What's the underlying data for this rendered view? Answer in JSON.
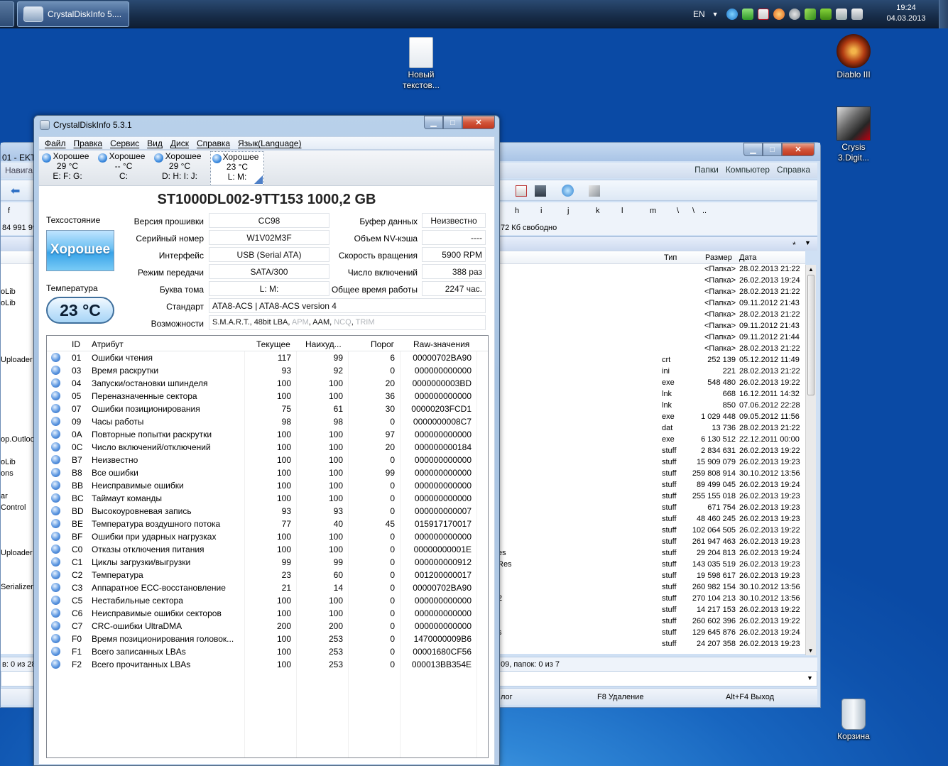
{
  "taskbar": {
    "task_button_label": "CrystalDiskInfo 5....",
    "lang": "EN",
    "time": "19:24",
    "date": "04.03.2013"
  },
  "desktop_icons": {
    "new_text": "Новый текстов...",
    "diablo": "Diablo III",
    "crysis": "Crysis 3.Digit...",
    "recycle": "Корзина"
  },
  "file_manager": {
    "title_fragment": "01 - EKT",
    "nav_fragment": "Навига",
    "menu": [
      "Папки",
      "Компьютер",
      "Справка"
    ],
    "drive_letters": [
      "h",
      "i",
      "j",
      "k",
      "l",
      "m",
      "\\",
      ".."
    ],
    "left_drive_fragment": "f",
    "left_free_fragment": "84 991 99",
    "free_text": "72 Кб свободно",
    "col_type": "Тип",
    "col_size": "Размер",
    "col_date": "Дата",
    "filter_star": "*",
    "left_names": [
      "",
      "",
      "oLib",
      "oLib",
      "",
      "",
      "",
      "",
      "Uploader",
      "",
      "",
      "",
      "",
      "",
      "",
      "op.Outlook",
      "",
      "oLib",
      "ons",
      "",
      "ar",
      "Control",
      "",
      "",
      "",
      "Uploader",
      "",
      "",
      "Serializers",
      "",
      "",
      "",
      "",
      "",
      "",
      ""
    ],
    "mid_names": [
      "",
      "",
      "",
      "",
      "",
      "",
      "",
      "",
      "",
      "",
      "",
      "",
      "",
      "",
      "",
      "",
      "",
      "",
      "",
      "",
      "",
      "",
      "",
      "",
      "",
      "es",
      "Res",
      "",
      "",
      "2",
      "",
      "",
      "s",
      "",
      "",
      ""
    ],
    "rows": [
      {
        "type": "",
        "size": "<Папка>",
        "date": "28.02.2013 21:22"
      },
      {
        "type": "",
        "size": "<Папка>",
        "date": "26.02.2013 19:24"
      },
      {
        "type": "",
        "size": "<Папка>",
        "date": "28.02.2013 21:22"
      },
      {
        "type": "",
        "size": "<Папка>",
        "date": "09.11.2012 21:43"
      },
      {
        "type": "",
        "size": "<Папка>",
        "date": "28.02.2013 21:22"
      },
      {
        "type": "",
        "size": "<Папка>",
        "date": "09.11.2012 21:43"
      },
      {
        "type": "",
        "size": "<Папка>",
        "date": "09.11.2012 21:44"
      },
      {
        "type": "",
        "size": "<Папка>",
        "date": "28.02.2013 21:22"
      },
      {
        "type": "crt",
        "size": "252 139",
        "date": "05.12.2012 11:49"
      },
      {
        "type": "ini",
        "size": "221",
        "date": "28.02.2013 21:22"
      },
      {
        "type": "exe",
        "size": "548 480",
        "date": "26.02.2013 19:22"
      },
      {
        "type": "lnk",
        "size": "668",
        "date": "16.12.2011 14:32"
      },
      {
        "type": "lnk",
        "size": "850",
        "date": "07.06.2012 22:28"
      },
      {
        "type": "exe",
        "size": "1 029 448",
        "date": "09.05.2012 11:56"
      },
      {
        "type": "dat",
        "size": "13 736",
        "date": "28.02.2013 21:22"
      },
      {
        "type": "exe",
        "size": "6 130 512",
        "date": "22.12.2011 00:00"
      },
      {
        "type": "stuff",
        "size": "2 834 631",
        "date": "26.02.2013 19:22"
      },
      {
        "type": "stuff",
        "size": "15 909 079",
        "date": "26.02.2013 19:23"
      },
      {
        "type": "stuff",
        "size": "259 808 914",
        "date": "30.10.2012 13:56"
      },
      {
        "type": "stuff",
        "size": "89 499 045",
        "date": "26.02.2013 19:24"
      },
      {
        "type": "stuff",
        "size": "255 155 018",
        "date": "26.02.2013 19:23"
      },
      {
        "type": "stuff",
        "size": "671 754",
        "date": "26.02.2013 19:23"
      },
      {
        "type": "stuff",
        "size": "48 460 245",
        "date": "26.02.2013 19:23"
      },
      {
        "type": "stuff",
        "size": "102 064 505",
        "date": "26.02.2013 19:22"
      },
      {
        "type": "stuff",
        "size": "261 947 463",
        "date": "26.02.2013 19:23"
      },
      {
        "type": "stuff",
        "size": "29 204 813",
        "date": "26.02.2013 19:24"
      },
      {
        "type": "stuff",
        "size": "143 035 519",
        "date": "26.02.2013 19:23"
      },
      {
        "type": "stuff",
        "size": "19 598 617",
        "date": "26.02.2013 19:23"
      },
      {
        "type": "stuff",
        "size": "260 982 154",
        "date": "30.10.2012 13:56"
      },
      {
        "type": "stuff",
        "size": "270 104 213",
        "date": "30.10.2012 13:56"
      },
      {
        "type": "stuff",
        "size": "14 217 153",
        "date": "26.02.2013 19:22"
      },
      {
        "type": "stuff",
        "size": "260 602 396",
        "date": "26.02.2013 19:22"
      },
      {
        "type": "stuff",
        "size": "129 645 876",
        "date": "26.02.2013 19:24"
      },
      {
        "type": "stuff",
        "size": "24 207 358",
        "date": "26.02.2013 19:23"
      }
    ],
    "status_left": "в: 0 из 28",
    "status_right": "09, папок: 0 из 7",
    "fkey_left": "лог",
    "fkey_f8": "F8 Удаление",
    "fkey_exit": "Alt+F4 Выход"
  },
  "cdi": {
    "title": "CrystalDiskInfo 5.3.1",
    "menu": [
      "Файл",
      "Правка",
      "Сервис",
      "Вид",
      "Диск",
      "Справка",
      "Язык(Language)"
    ],
    "disk_tabs": [
      {
        "status": "Хорошее",
        "temp": "29 °C",
        "letters": "E: F: G:"
      },
      {
        "status": "Хорошее",
        "temp": "-- °C",
        "letters": "C:"
      },
      {
        "status": "Хорошее",
        "temp": "29 °C",
        "letters": "D: H: I: J:"
      },
      {
        "status": "Хорошее",
        "temp": "23 °C",
        "letters": "L: M:"
      }
    ],
    "model": "ST1000DL002-9TT153  1000,2 GB",
    "health_label": "Техсостояние",
    "health_value": "Хорошее",
    "temp_label": "Температура",
    "temp_value": "23 °C",
    "fields_left": [
      {
        "label": "Версия прошивки",
        "value": "CC98"
      },
      {
        "label": "Серийный номер",
        "value": "W1V02M3F"
      },
      {
        "label": "Интерфейс",
        "value": "USB (Serial ATA)"
      },
      {
        "label": "Режим передачи",
        "value": "SATA/300"
      },
      {
        "label": "Буква тома",
        "value": "L: M:"
      }
    ],
    "fields_right": [
      {
        "label": "Буфер данных",
        "value": "Неизвестно"
      },
      {
        "label": "Объем NV-кэша",
        "value": "----"
      },
      {
        "label": "Скорость вращения",
        "value": "5900 RPM"
      },
      {
        "label": "Число включений",
        "value": "388 раз"
      },
      {
        "label": "Общее время работы",
        "value": "2247 час."
      }
    ],
    "standard_label": "Стандарт",
    "standard_value": "ATA8-ACS | ATA8-ACS version 4",
    "features_label": "Возможности",
    "features": [
      "S.M.A.R.T.",
      "48bit LBA",
      "APM",
      "AAM",
      "NCQ",
      "TRIM"
    ],
    "features_dim": [
      false,
      false,
      true,
      false,
      true,
      true
    ],
    "table_headers": [
      "ID",
      "Атрибут",
      "Текущее",
      "Наихуд...",
      "Порог",
      "Raw-значения"
    ],
    "attributes": [
      {
        "id": "01",
        "name": "Ошибки чтения",
        "cur": "117",
        "worst": "99",
        "thr": "6",
        "raw": "00000702BA90"
      },
      {
        "id": "03",
        "name": "Время раскрутки",
        "cur": "93",
        "worst": "92",
        "thr": "0",
        "raw": "000000000000"
      },
      {
        "id": "04",
        "name": "Запуски/остановки шпинделя",
        "cur": "100",
        "worst": "100",
        "thr": "20",
        "raw": "0000000003BD"
      },
      {
        "id": "05",
        "name": "Переназначенные сектора",
        "cur": "100",
        "worst": "100",
        "thr": "36",
        "raw": "000000000000"
      },
      {
        "id": "07",
        "name": "Ошибки позиционирования",
        "cur": "75",
        "worst": "61",
        "thr": "30",
        "raw": "00000203FCD1"
      },
      {
        "id": "09",
        "name": "Часы работы",
        "cur": "98",
        "worst": "98",
        "thr": "0",
        "raw": "0000000008C7"
      },
      {
        "id": "0A",
        "name": "Повторные попытки раскрутки",
        "cur": "100",
        "worst": "100",
        "thr": "97",
        "raw": "000000000000"
      },
      {
        "id": "0C",
        "name": "Число включений/отключений",
        "cur": "100",
        "worst": "100",
        "thr": "20",
        "raw": "000000000184"
      },
      {
        "id": "B7",
        "name": "Неизвестно",
        "cur": "100",
        "worst": "100",
        "thr": "0",
        "raw": "000000000000"
      },
      {
        "id": "B8",
        "name": "Все ошибки",
        "cur": "100",
        "worst": "100",
        "thr": "99",
        "raw": "000000000000"
      },
      {
        "id": "BB",
        "name": "Неисправимые ошибки",
        "cur": "100",
        "worst": "100",
        "thr": "0",
        "raw": "000000000000"
      },
      {
        "id": "BC",
        "name": "Таймаут команды",
        "cur": "100",
        "worst": "100",
        "thr": "0",
        "raw": "000000000000"
      },
      {
        "id": "BD",
        "name": "Высокоуровневая запись",
        "cur": "93",
        "worst": "93",
        "thr": "0",
        "raw": "000000000007"
      },
      {
        "id": "BE",
        "name": "Температура воздушного потока",
        "cur": "77",
        "worst": "40",
        "thr": "45",
        "raw": "015917170017"
      },
      {
        "id": "BF",
        "name": "Ошибки при ударных нагрузках",
        "cur": "100",
        "worst": "100",
        "thr": "0",
        "raw": "000000000000"
      },
      {
        "id": "C0",
        "name": "Отказы отключения питания",
        "cur": "100",
        "worst": "100",
        "thr": "0",
        "raw": "00000000001E"
      },
      {
        "id": "C1",
        "name": "Циклы загрузки/выгрузки",
        "cur": "99",
        "worst": "99",
        "thr": "0",
        "raw": "000000000912"
      },
      {
        "id": "C2",
        "name": "Температура",
        "cur": "23",
        "worst": "60",
        "thr": "0",
        "raw": "001200000017"
      },
      {
        "id": "C3",
        "name": "Аппаратное ECC-восстановление",
        "cur": "21",
        "worst": "14",
        "thr": "0",
        "raw": "00000702BA90"
      },
      {
        "id": "C5",
        "name": "Нестабильные сектора",
        "cur": "100",
        "worst": "100",
        "thr": "0",
        "raw": "000000000000"
      },
      {
        "id": "C6",
        "name": "Неисправимые ошибки секторов",
        "cur": "100",
        "worst": "100",
        "thr": "0",
        "raw": "000000000000"
      },
      {
        "id": "C7",
        "name": "CRC-ошибки UltraDMA",
        "cur": "200",
        "worst": "200",
        "thr": "0",
        "raw": "000000000000"
      },
      {
        "id": "F0",
        "name": "Время позиционирования головок...",
        "cur": "100",
        "worst": "253",
        "thr": "0",
        "raw": "1470000009B6"
      },
      {
        "id": "F1",
        "name": "Всего записанных LBAs",
        "cur": "100",
        "worst": "253",
        "thr": "0",
        "raw": "00001680CF56"
      },
      {
        "id": "F2",
        "name": "Всего прочитанных LBAs",
        "cur": "100",
        "worst": "253",
        "thr": "0",
        "raw": "000013BB354E"
      }
    ]
  }
}
